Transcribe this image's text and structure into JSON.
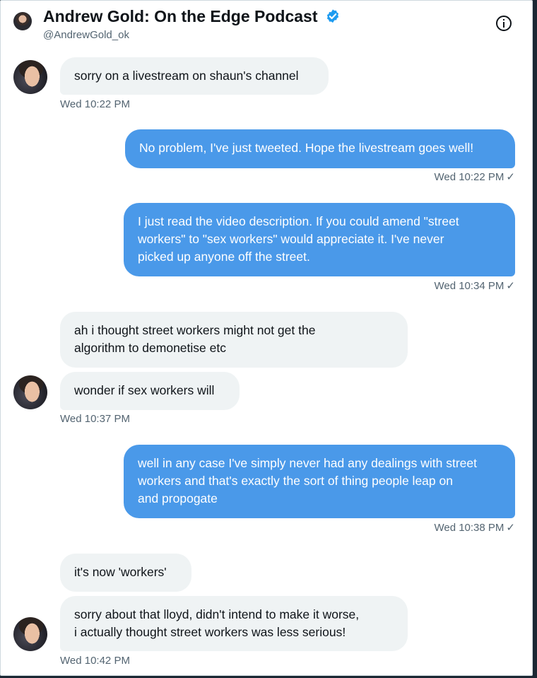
{
  "header": {
    "name": "Andrew Gold: On the Edge Podcast",
    "handle": "@AndrewGold_ok"
  },
  "messages": [
    {
      "side": "in",
      "lines": [
        "sorry on a livestream on shaun's channel"
      ],
      "time": "Wed 10:22 PM"
    },
    {
      "side": "out",
      "lines": [
        "No problem, I've just tweeted. Hope the livestream goes well!"
      ],
      "time": "Wed 10:22 PM"
    },
    {
      "side": "out",
      "lines": [
        "I just read the video description. If you could amend \"street",
        "workers\" to \"sex workers\" would appreciate it. I've never",
        "picked up anyone off the street."
      ],
      "time": "Wed 10:34 PM"
    },
    {
      "side": "in",
      "lines": [
        "ah i thought street workers might not get the",
        "algorithm to demonetise etc"
      ]
    },
    {
      "side": "in",
      "lines": [
        "wonder if sex workers will"
      ],
      "time": "Wed 10:37 PM"
    },
    {
      "side": "out",
      "lines": [
        "well in any case I've simply never had any dealings with street",
        "workers and that's exactly the sort of thing people leap on",
        "and propogate"
      ],
      "time": "Wed 10:38 PM"
    },
    {
      "side": "in",
      "lines": [
        "it's now 'workers'"
      ]
    },
    {
      "side": "in",
      "lines": [
        "sorry about that lloyd, didn't intend to make it worse,",
        "i actually thought street workers was less serious!"
      ],
      "time": "Wed 10:42 PM"
    }
  ],
  "colors": {
    "outgoing": "#4a99e9",
    "incoming": "#eff3f4",
    "verified": "#1d9bf0"
  },
  "icons": {
    "verified": "verified-badge-icon",
    "info": "info-icon",
    "read": "checkmark-icon"
  }
}
